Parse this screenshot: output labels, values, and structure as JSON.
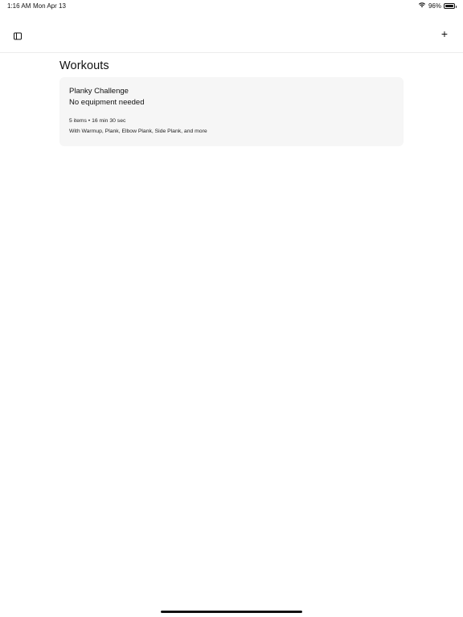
{
  "status_bar": {
    "time": "1:16 AM",
    "date": "Mon Apr 13",
    "battery_percent": "96%",
    "battery_level": 0.96,
    "icons": [
      "wifi-icon",
      "battery-icon"
    ]
  },
  "nav_bar": {
    "left_icon": "sidebar-toggle-icon",
    "right_label": "+"
  },
  "page": {
    "title": "Workouts"
  },
  "workouts": [
    {
      "title": "Planky Challenge",
      "subtitle": "No equipment needed",
      "meta": "5 items • 16 min 30 sec",
      "items_summary": "With Warmup, Plank, Elbow Plank, Side Plank, and more"
    }
  ]
}
